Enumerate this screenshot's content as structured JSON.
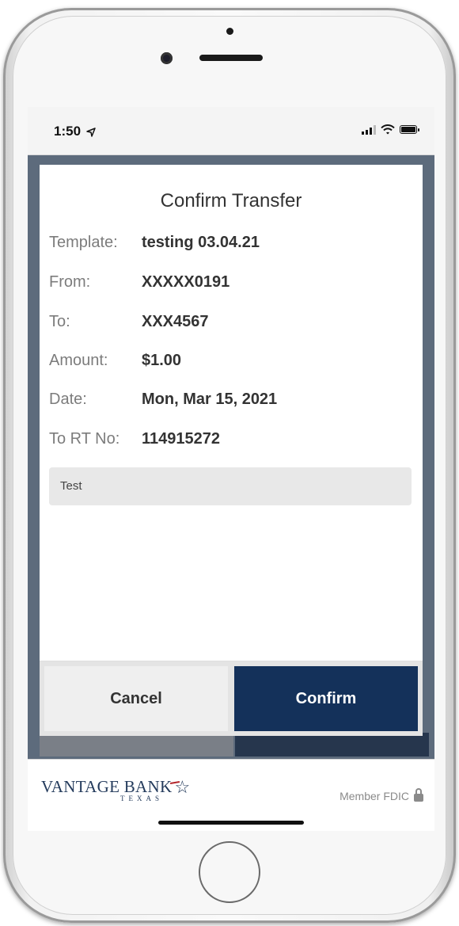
{
  "status_bar": {
    "time": "1:50"
  },
  "dialog": {
    "title": "Confirm Transfer",
    "fields": [
      {
        "label": "Template:",
        "value": "testing 03.04.21"
      },
      {
        "label": "From:",
        "value": "XXXXX0191"
      },
      {
        "label": "To:",
        "value": "XXX4567"
      },
      {
        "label": "Amount:",
        "value": "$1.00"
      },
      {
        "label": "Date:",
        "value": "Mon, Mar 15, 2021"
      },
      {
        "label": "To RT No:",
        "value": "114915272"
      }
    ],
    "memo": "Test",
    "cancel_label": "Cancel",
    "confirm_label": "Confirm"
  },
  "footer": {
    "logo_main": "VANTAGE BANK",
    "logo_sub": "TEXAS",
    "fdic": "Member FDIC"
  },
  "colors": {
    "brand_navy": "#14315a",
    "overlay": "#5d6b7c"
  }
}
